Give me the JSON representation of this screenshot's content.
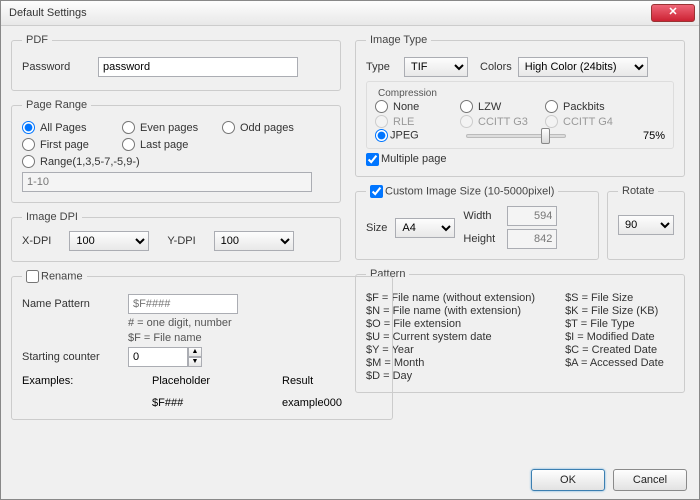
{
  "window": {
    "title": "Default Settings",
    "close_glyph": "✕"
  },
  "pdf": {
    "legend": "PDF",
    "password_label": "Password",
    "password_value": "password"
  },
  "page_range": {
    "legend": "Page Range",
    "all": "All Pages",
    "even": "Even pages",
    "odd": "Odd pages",
    "first": "First page",
    "last": "Last page",
    "range": "Range(1,3,5-7,-5,9-)",
    "range_value": "1-10"
  },
  "dpi": {
    "legend": "Image DPI",
    "x_label": "X-DPI",
    "x_value": "100",
    "y_label": "Y-DPI",
    "y_value": "100"
  },
  "rename": {
    "checkbox": "Rename",
    "name_pattern_label": "Name Pattern",
    "name_pattern_placeholder": "$F####",
    "hint1": "# = one digit, number",
    "hint2": "$F = File name",
    "starting_counter_label": "Starting counter",
    "starting_counter_value": "0",
    "examples_label": "Examples:",
    "placeholder_label": "Placeholder",
    "placeholder_value": "$F###",
    "result_label": "Result",
    "result_value": "example000"
  },
  "image_type": {
    "legend": "Image Type",
    "type_label": "Type",
    "type_value": "TIF",
    "colors_label": "Colors",
    "colors_value": "High Color (24bits)",
    "compression_legend": "Compression",
    "none": "None",
    "lzw": "LZW",
    "packbits": "Packbits",
    "rle": "RLE",
    "ccittg3": "CCITT G3",
    "ccittg4": "CCITT G4",
    "jpeg": "JPEG",
    "quality": "75%",
    "multiple_page": "Multiple page"
  },
  "image_size": {
    "checkbox": "Custom Image Size (10-5000pixel)",
    "size_label": "Size",
    "size_value": "A4",
    "width_label": "Width",
    "width_value": "594",
    "height_label": "Height",
    "height_value": "842",
    "rotate_legend": "Rotate",
    "rotate_value": "90"
  },
  "pattern": {
    "legend": "Pattern",
    "f": "$F = File name (without extension)",
    "n": "$N = File name (with extension)",
    "o": "$O = File extension",
    "u": "$U = Current system date",
    "y": "$Y = Year",
    "m": "$M = Month",
    "d": "$D = Day",
    "s": "$S = File Size",
    "k": "$K = File Size (KB)",
    "t": "$T = File Type",
    "i": "$I = Modified Date",
    "c": "$C = Created Date",
    "a": "$A = Accessed Date"
  },
  "footer": {
    "ok": "OK",
    "cancel": "Cancel"
  }
}
